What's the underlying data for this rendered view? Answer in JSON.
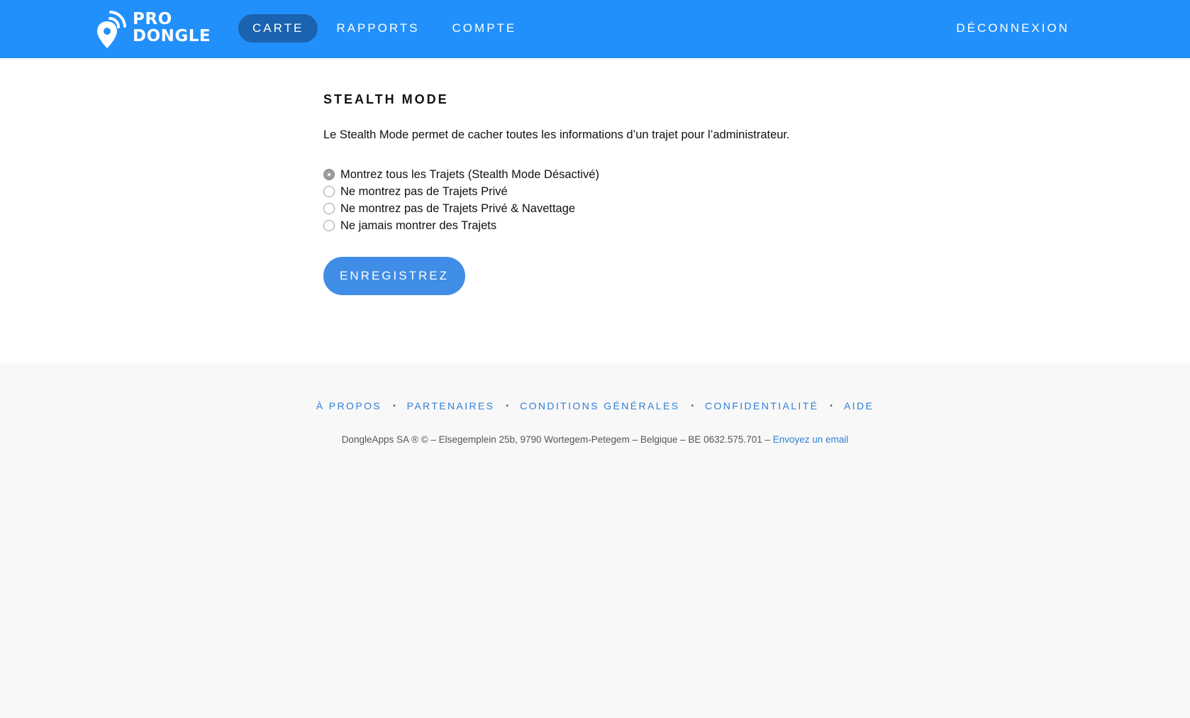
{
  "brand": {
    "logo_line1": "PRO",
    "logo_line2": "DONGLE",
    "colors": {
      "header": "#2290fb",
      "nav_active": "#1a63b0",
      "button": "#3f8de6",
      "link": "#2f7fd8"
    }
  },
  "nav": {
    "items": [
      {
        "label": "CARTE",
        "active": true
      },
      {
        "label": "RAPPORTS",
        "active": false
      },
      {
        "label": "COMPTE",
        "active": false
      }
    ],
    "logout_label": "DÉCONNEXION"
  },
  "main": {
    "title": "STEALTH MODE",
    "description": "Le Stealth Mode permet de cacher toutes les informations d’un trajet pour l’administrateur.",
    "options": [
      {
        "label": "Montrez tous les Trajets (Stealth Mode Désactivé)",
        "checked": true
      },
      {
        "label": "Ne montrez pas de Trajets Privé",
        "checked": false
      },
      {
        "label": "Ne montrez pas de Trajets Privé & Navettage",
        "checked": false
      },
      {
        "label": "Ne jamais montrer des Trajets",
        "checked": false
      }
    ],
    "save_label": "ENREGISTREZ"
  },
  "footer": {
    "links": [
      "À PROPOS",
      "PARTENAIRES",
      "CONDITIONS GÉNÉRALES",
      "CONFIDENTIALITÉ",
      "AIDE"
    ],
    "separator": "•",
    "copyright": "DongleApps SA ® © – Elsegemplein 25b, 9790 Wortegem-Petegem – Belgique – BE 0632.575.701 – ",
    "email_label": "Envoyez un email"
  }
}
